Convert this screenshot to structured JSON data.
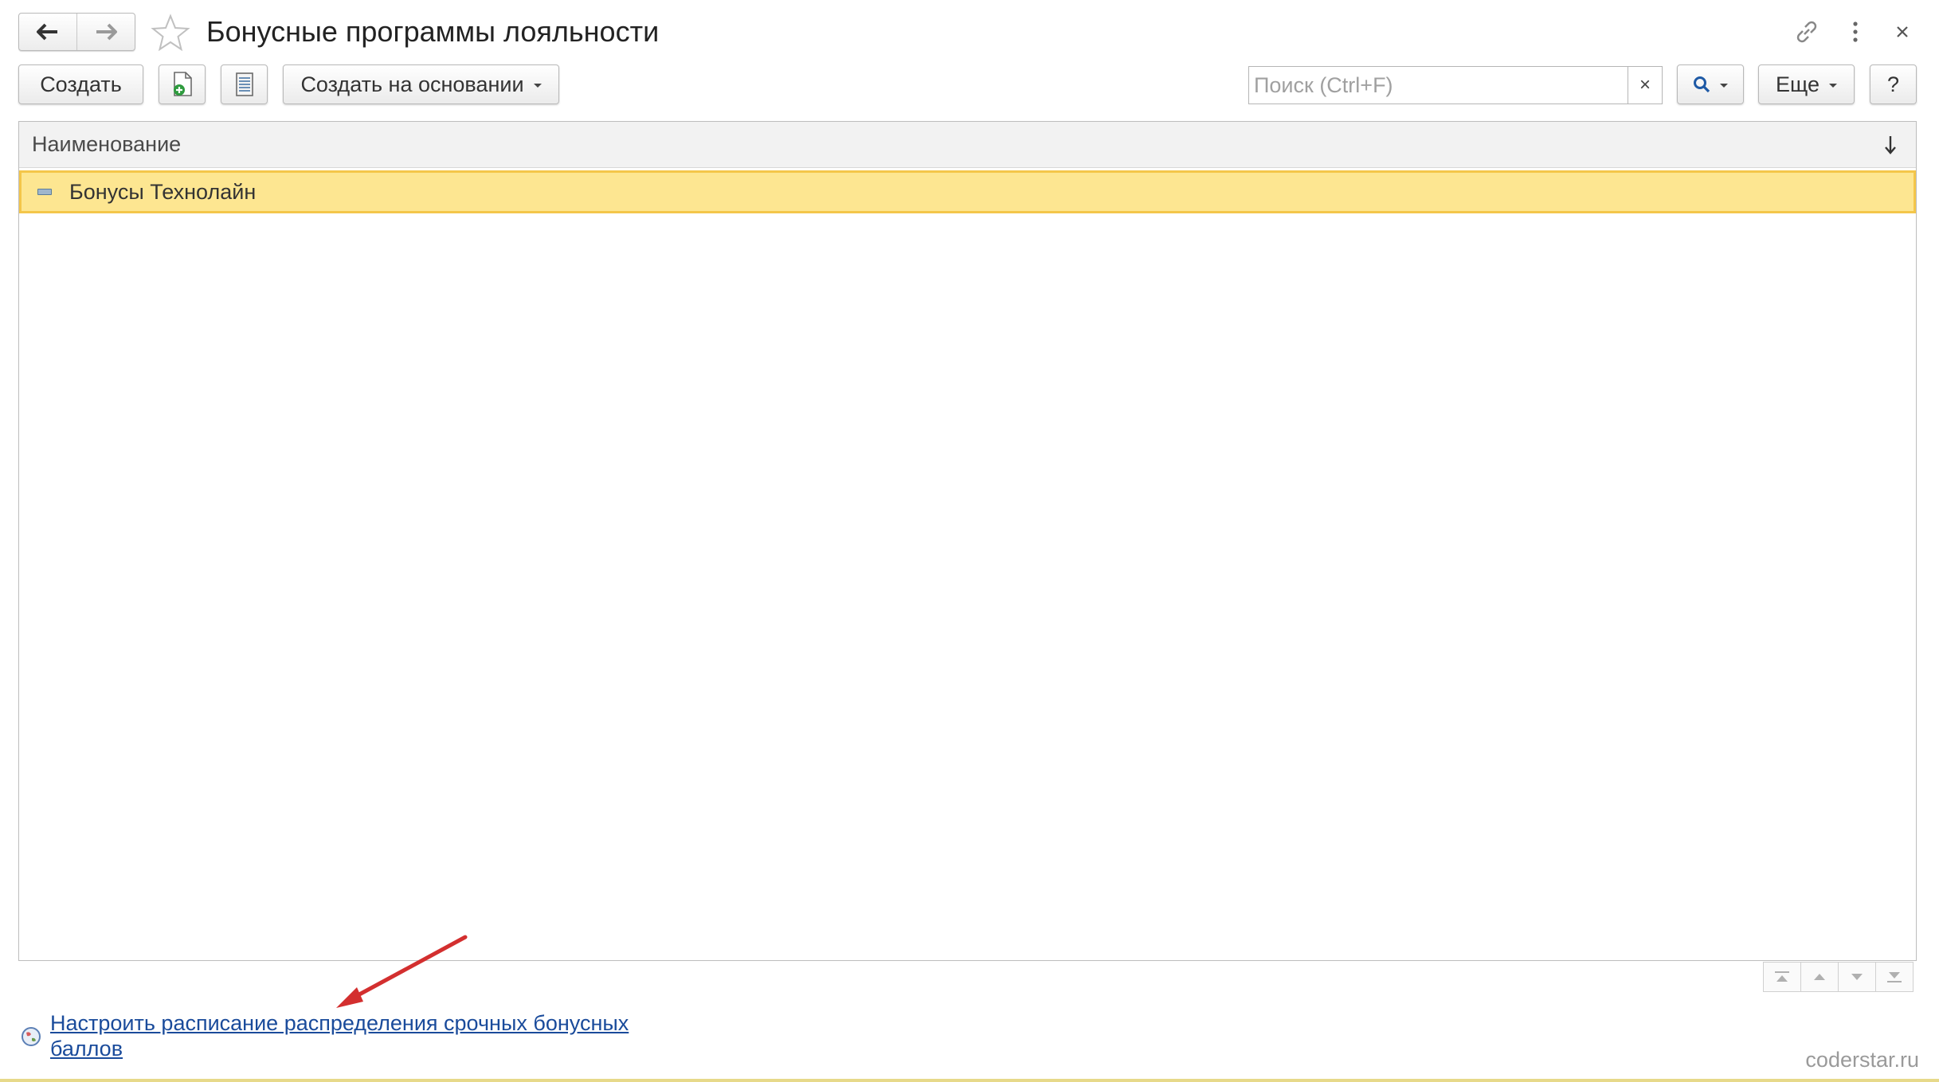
{
  "window": {
    "title": "Бонусные программы лояльности"
  },
  "toolbar": {
    "create_label": "Создать",
    "create_based_label": "Создать на основании",
    "more_label": "Еще",
    "help_label": "?"
  },
  "search": {
    "placeholder": "Поиск (Ctrl+F)",
    "value": "",
    "clear_label": "×"
  },
  "table": {
    "columns": [
      "Наименование"
    ],
    "rows": [
      {
        "name": "Бонусы Технолайн",
        "selected": true
      }
    ]
  },
  "footer": {
    "link_text": "Настроить расписание распределения срочных бонусных баллов",
    "watermark": "coderstar.ru"
  },
  "icons": {
    "back": "arrow-left-icon",
    "forward": "arrow-right-icon",
    "favorite": "star-icon",
    "link": "link-icon",
    "menu": "more-vertical-icon",
    "close": "close-icon",
    "copy": "document-add-icon",
    "list": "list-icon",
    "search": "search-icon",
    "sort": "sort-down-icon",
    "row": "catalog-item-icon",
    "link_item": "globe-icon"
  },
  "colors": {
    "selected_row": "#fde691",
    "selected_row_border": "#f4c64a",
    "link": "#1a4b9b",
    "annotation_arrow": "#d32f2f"
  }
}
